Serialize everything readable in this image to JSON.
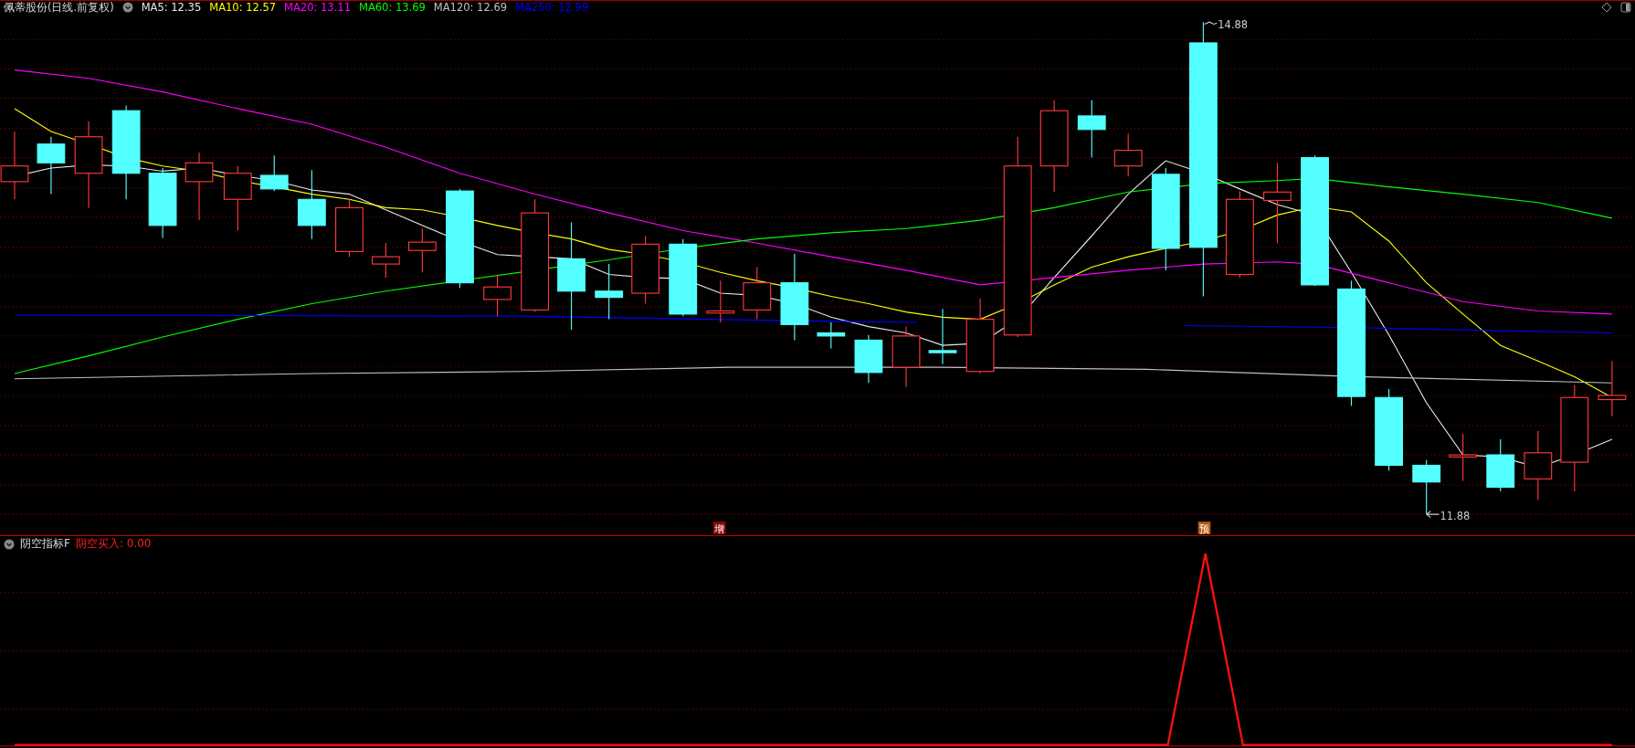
{
  "stock_header": {
    "title": "佩蒂股份(日线.前复权)",
    "moving_averages": [
      {
        "label": "MA5: 12.35",
        "color": "#e8e8e8"
      },
      {
        "label": "MA10: 12.57",
        "color": "#ffff00"
      },
      {
        "label": "MA20: 13.11",
        "color": "#ff00ff"
      },
      {
        "label": "MA60: 13.69",
        "color": "#00ff00"
      },
      {
        "label": "MA120: 12.69",
        "color": "#c0c0c0"
      },
      {
        "label": "MA250: 12.99",
        "color": "#0000ff"
      }
    ]
  },
  "main_chart": {
    "high_label": "14.88",
    "low_label": "11.88",
    "markers": [
      {
        "text": "增",
        "color": "#8b0a00"
      },
      {
        "text": "预",
        "color": "#b85a10"
      }
    ]
  },
  "indicator": {
    "title": "阴空指标F",
    "reading": "阴空买入: 0.00"
  }
}
